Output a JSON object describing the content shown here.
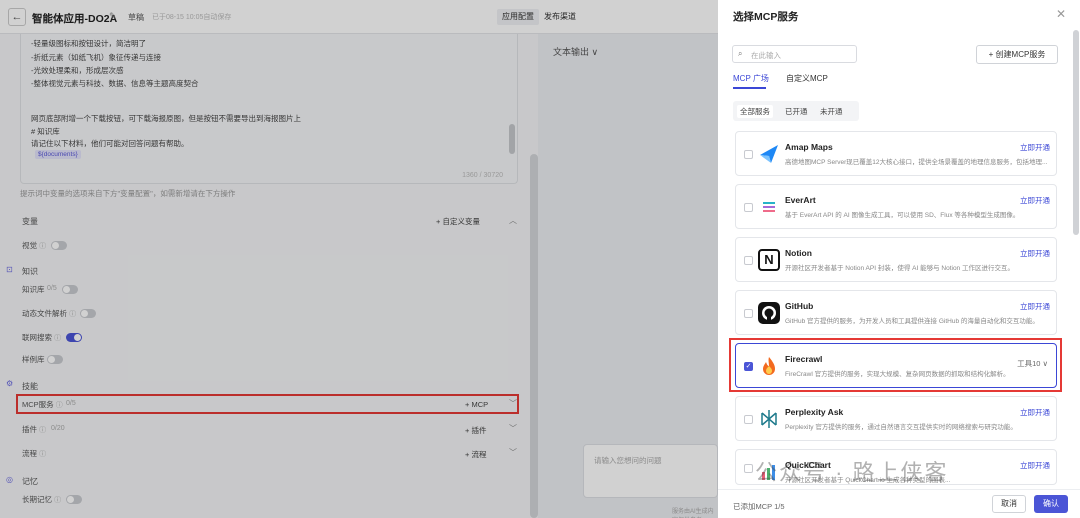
{
  "header": {
    "back_icon": "back-arrow-icon",
    "title": "智能体应用-DO2A",
    "draft_label": "草稿",
    "autosave": "已于08-15 10:05自动保存",
    "config_tab": "应用配置",
    "publish_tab": "发布渠道"
  },
  "prompt": {
    "lines": [
      "-轻量级图标和按钮设计，简洁明了",
      "-折纸元素（如纸飞机）象征传递与连接",
      "-光效处理柔和，形成层次感",
      "-整体视觉元素与科技、数据、信息等主题高度契合",
      "网页底部附增一个下载按钮，可下载海报原图，但是按钮不需要导出到海报图片上",
      "# 知识库",
      "请记住以下材料，他们可能对回答问题有帮助。"
    ],
    "variable_tag": "${documents}",
    "counter": "1360 / 30720",
    "hint": "提示词中变量的选项来自下方\"变量配置\"，如需新增请在下方操作"
  },
  "variables": {
    "title": "变量",
    "add_label": "+ 自定义变量",
    "vision_label": "视觉"
  },
  "knowledge": {
    "title": "知识",
    "kb_label": "知识库",
    "kb_count": "0/5",
    "dynamic_label": "动态文件解析",
    "web_search_label": "联网搜索",
    "sample_label": "样例库"
  },
  "skills": {
    "title": "技能",
    "mcp_label": "MCP服务",
    "mcp_count": "0/5",
    "mcp_add": "+ MCP",
    "plugin_label": "插件",
    "plugin_count": "0/20",
    "plugin_add": "+ 插件",
    "flow_label": "流程",
    "flow_add": "+ 流程"
  },
  "memory": {
    "title": "记忆",
    "long_term_label": "长期记忆"
  },
  "middle": {
    "text_format": "文本输出 ∨",
    "chat_placeholder": "请输入您想问的问题",
    "footer": "服务由AI生成内容仅供参考"
  },
  "drawer": {
    "title": "选择MCP服务",
    "search_placeholder": "在此输入",
    "create_button": "+ 创建MCP服务",
    "tabs": [
      "MCP 广场",
      "自定义MCP"
    ],
    "filters": [
      "全部服务",
      "已开通",
      "未开通"
    ],
    "items": [
      {
        "name": "Amap Maps",
        "desc": "高德地图MCP Server现已覆盖12大核心接口，提供全场景覆盖的地理信息服务，包括地理...",
        "action": "立即开通",
        "icon": "amap-logo-icon"
      },
      {
        "name": "EverArt",
        "desc": "基于 EverArt API 的 AI 图像生成工具，可以使用 SD、Flux 等各种模型生成图像。",
        "action": "立即开通",
        "icon": "everart-logo-icon"
      },
      {
        "name": "Notion",
        "desc": "开源社区开发者基于 Notion API 封装，使得 AI 能够与 Notion 工作区进行交互。",
        "action": "立即开通",
        "icon": "notion-logo-icon"
      },
      {
        "name": "GitHub",
        "desc": "GitHub 官方提供的服务，为开发人员和工具提供连接 GitHub 的海量自动化和交互功能。",
        "action": "立即开通",
        "icon": "github-logo-icon"
      },
      {
        "name": "Firecrawl",
        "desc": "FireCrawl 官方提供的服务，实现大规模、复杂网页数据的抓取和结构化解析。",
        "tools": "工具10 ∨",
        "icon": "firecrawl-logo-icon",
        "checked": true
      },
      {
        "name": "Perplexity Ask",
        "desc": "Perplexity 官方提供的服务，通过自然语言交互提供实时的网络搜索与研究功能。",
        "action": "立即开通",
        "icon": "perplexity-logo-icon"
      },
      {
        "name": "QuickChart",
        "desc": "开源社区开发者基于 QuickChart.io 生成各种类型的图表...",
        "action": "立即开通",
        "icon": "quickchart-logo-icon"
      }
    ],
    "added": "已添加MCP 1/5",
    "cancel": "取消",
    "confirm": "确认"
  },
  "watermark": "公众号 · 路上侠客"
}
